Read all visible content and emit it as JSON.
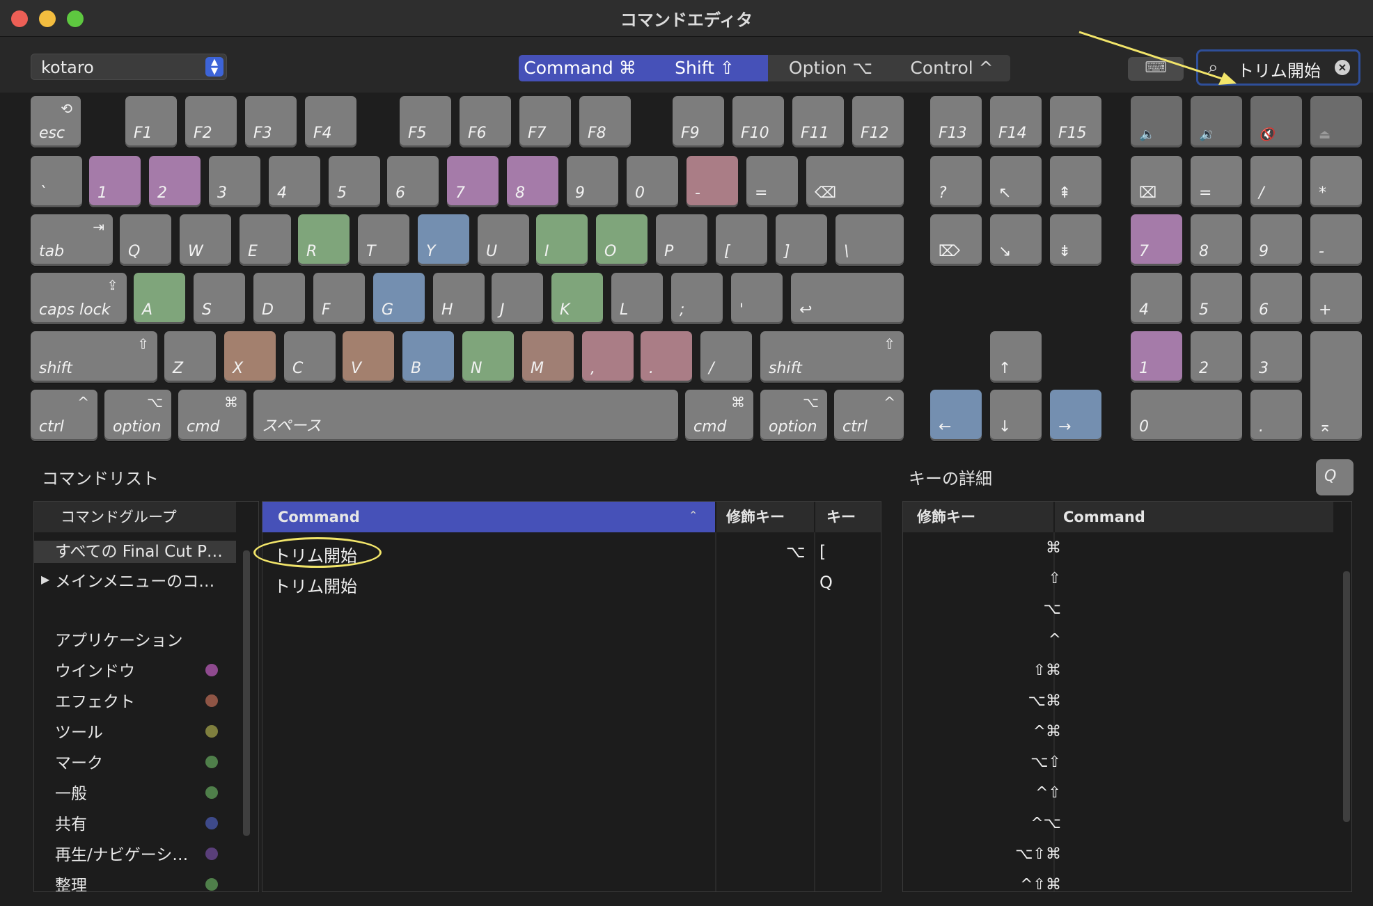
{
  "window": {
    "title": "コマンドエディタ"
  },
  "toolbar": {
    "user": "kotaro",
    "modifiers": [
      {
        "label": "Command ⌘",
        "active": true
      },
      {
        "label": "Shift ⇧",
        "active": true
      },
      {
        "label": "Option ⌥",
        "active": false
      },
      {
        "label": "Control ^",
        "active": false
      }
    ],
    "search_value": "トリム開始"
  },
  "keyboard": {
    "colors": {
      "default": "#7d7d7d",
      "purple": "#a57ba9",
      "pink": "#aa7d86",
      "green": "#7fa57b",
      "blue": "#748fb0",
      "orange": "#a3806e",
      "brown": "#a07f74"
    }
  },
  "command_list": {
    "title": "コマンドリスト",
    "groups_header": "コマンドグループ",
    "groups": [
      {
        "label": "すべての Final Cut P…"
      },
      {
        "label": "メインメニューのコ…"
      },
      {
        "label": "アプリケーション",
        "color": ""
      },
      {
        "label": "ウインドウ",
        "color": "#8f4a8f"
      },
      {
        "label": "エフェクト",
        "color": "#8f5545"
      },
      {
        "label": "ツール",
        "color": "#7f7f3e"
      },
      {
        "label": "マーク",
        "color": "#4f7f4a"
      },
      {
        "label": "一般",
        "color": "#4f7f4a"
      },
      {
        "label": "共有",
        "color": "#3e4a8a"
      },
      {
        "label": "再生/ナビゲーシ…",
        "color": "#5a3f7a"
      },
      {
        "label": "整理",
        "color": "#4f7f4a"
      }
    ],
    "columns": [
      "Command",
      "修飾キー",
      "キー"
    ],
    "rows": [
      {
        "command": "トリム開始",
        "modifier": "⌥",
        "key": "["
      },
      {
        "command": "トリム開始",
        "modifier": "",
        "key": "Q"
      }
    ]
  },
  "key_detail": {
    "title": "キーの詳細",
    "key_button": "Q",
    "columns": [
      "修飾キー",
      "Command"
    ],
    "modifiers": [
      "⌘",
      "⇧",
      "⌥",
      "^",
      "⇧⌘",
      "⌥⌘",
      "^⌘",
      "⌥⇧",
      "^⇧",
      "^⌥",
      "⌥⇧⌘",
      "^⇧⌘"
    ]
  }
}
